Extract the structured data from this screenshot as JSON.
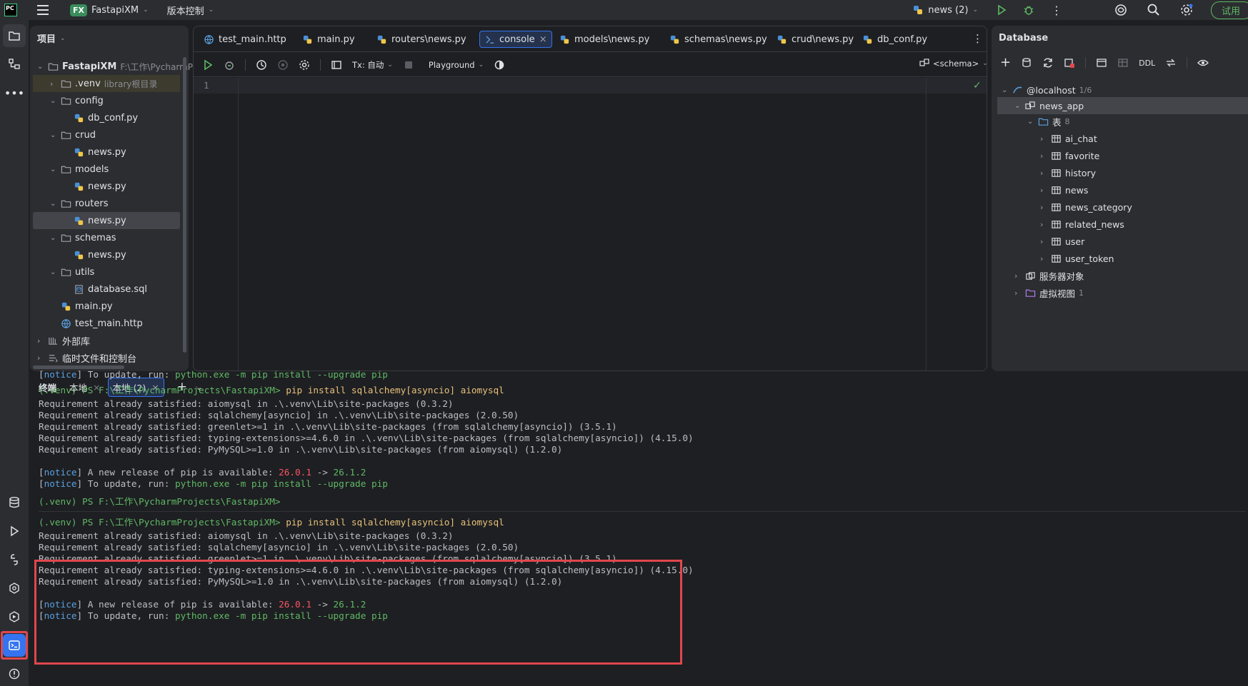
{
  "titlebar": {
    "project": "FastapiXM",
    "project_badge": "FX",
    "vcs": "版本控制",
    "run_config": "news (2)",
    "trial": "试用"
  },
  "project_panel": {
    "title": "项目",
    "root": "FastapiXM",
    "root_path": "F:\\工作\\PycharmP",
    "items": [
      {
        "label": ".venv",
        "hint": "library根目录",
        "type": "folder"
      },
      {
        "label": "config",
        "type": "folder"
      },
      {
        "label": "db_conf.py",
        "type": "py"
      },
      {
        "label": "crud",
        "type": "folder"
      },
      {
        "label": "news.py",
        "type": "py"
      },
      {
        "label": "models",
        "type": "folder"
      },
      {
        "label": "news.py",
        "type": "py"
      },
      {
        "label": "routers",
        "type": "folder"
      },
      {
        "label": "news.py",
        "type": "py"
      },
      {
        "label": "schemas",
        "type": "folder"
      },
      {
        "label": "news.py",
        "type": "py"
      },
      {
        "label": "utils",
        "type": "folder"
      },
      {
        "label": "database.sql",
        "type": "sql"
      },
      {
        "label": "main.py",
        "type": "py"
      },
      {
        "label": "test_main.http",
        "type": "http"
      },
      {
        "label": "外部库",
        "type": "lib"
      },
      {
        "label": "临时文件和控制台",
        "type": "scratch"
      }
    ]
  },
  "editor": {
    "tabs": [
      "test_main.http",
      "main.py",
      "routers\\news.py",
      "console",
      "models\\news.py",
      "schemas\\news.py",
      "crud\\news.py",
      "db_conf.py"
    ],
    "toolbar": {
      "tx": "Tx: 自动",
      "playground": "Playground",
      "schema": "<schema>"
    },
    "line1": "1"
  },
  "database": {
    "title": "Database",
    "ddl": "DDL",
    "host": "@localhost",
    "host_count": "1/6",
    "db": "news_app",
    "tables_label": "表",
    "tables_count": "8",
    "tables": [
      "ai_chat",
      "favorite",
      "history",
      "news",
      "news_category",
      "related_news",
      "user",
      "user_token"
    ],
    "server_objects": "服务器对象",
    "virtual_views": "虚拟视图",
    "virtual_count": "1"
  },
  "terminal": {
    "tab_label": "终端",
    "tabs": [
      "本地",
      "本地 (2)"
    ],
    "prompt": "(.venv) PS F:\\工作\\PycharmProjects\\FastapiXM>",
    "cmd": "pip install sqlalchemy[asyncio] aiomysql",
    "req": [
      "Requirement already satisfied: aiomysql in .\\.venv\\Lib\\site-packages (0.3.2)",
      "Requirement already satisfied: sqlalchemy[asyncio] in .\\.venv\\Lib\\site-packages (2.0.50)",
      "Requirement already satisfied: greenlet>=1 in .\\.venv\\Lib\\site-packages (from sqlalchemy[asyncio]) (3.5.1)",
      "Requirement already satisfied: typing-extensions>=4.6.0 in .\\.venv\\Lib\\site-packages (from sqlalchemy[asyncio]) (4.15.0)",
      "Requirement already satisfied: PyMySQL>=1.0 in .\\.venv\\Lib\\site-packages (from aiomysql) (1.2.0)"
    ],
    "notice_tag": "notice",
    "notice1_pre": "A new release of pip is available: ",
    "old_ver": "26.0.1",
    "arrow": " -> ",
    "new_ver": "26.1.2",
    "notice2_pre": "To update, run: ",
    "update_cmd": "python.exe -m pip install --upgrade pip"
  },
  "colors": {
    "accent": "#3574f0",
    "highlight_box": "#e0474d",
    "prompt": "#5fb865",
    "cmd": "#e5c07b",
    "notice": "#5aa0e0"
  }
}
